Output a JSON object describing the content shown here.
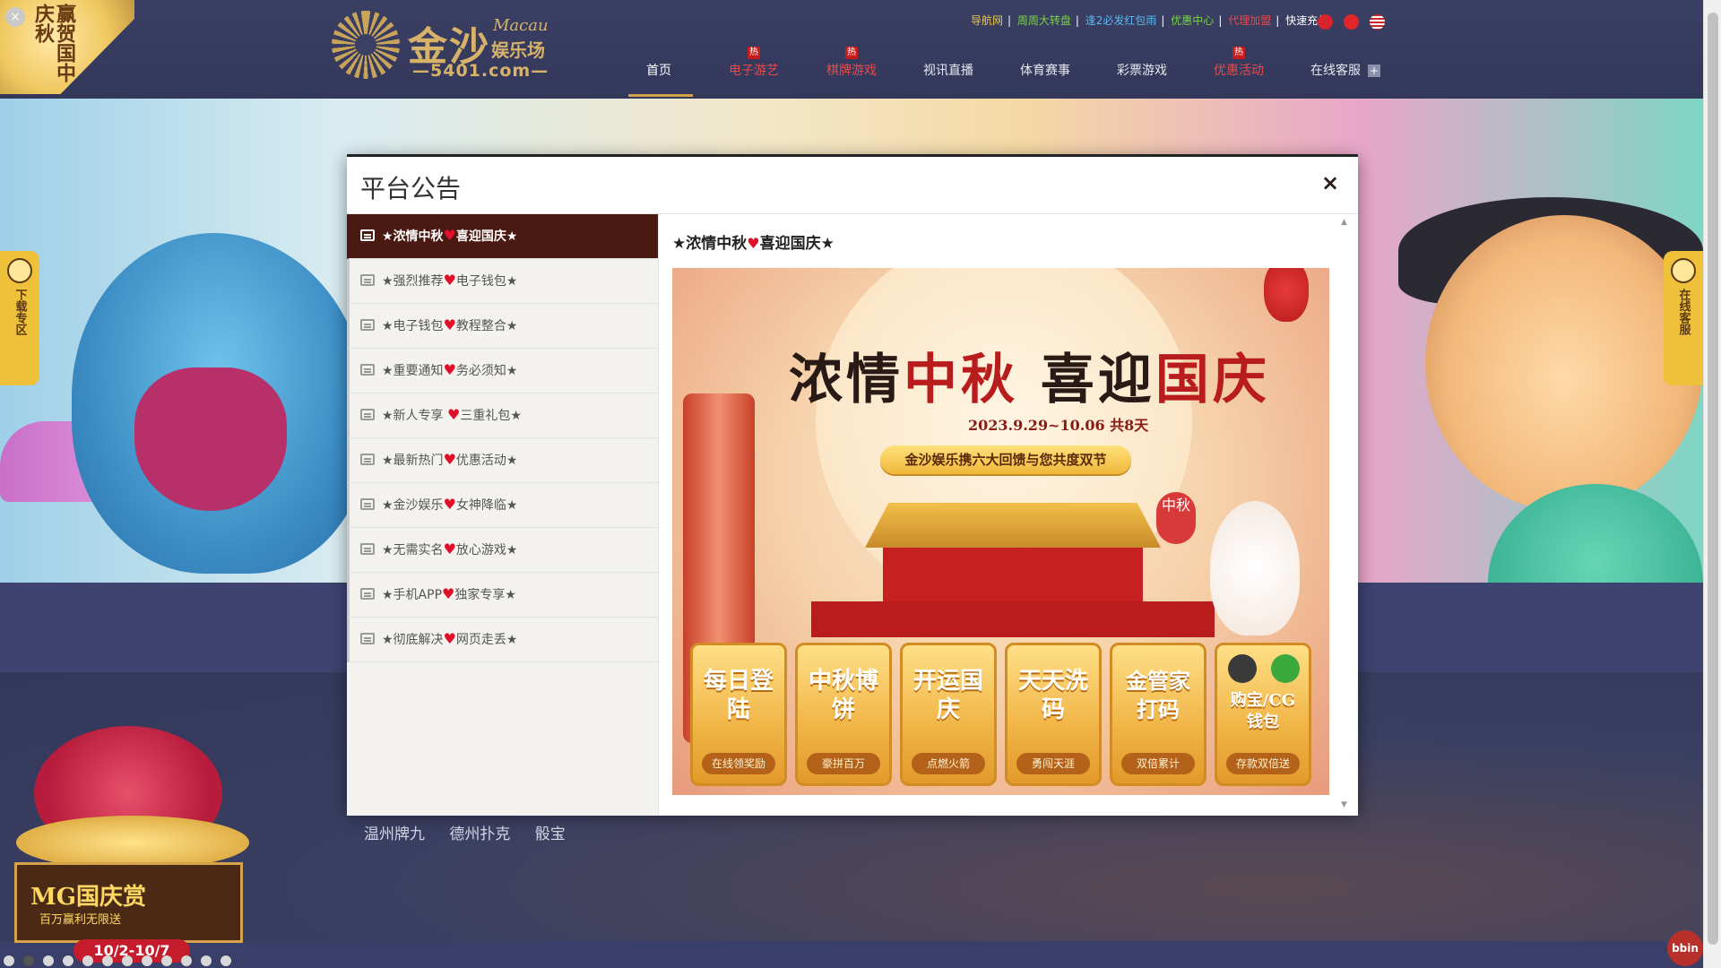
{
  "header": {
    "festival_text": "赢贺国中庆秋",
    "logo_main": "金沙",
    "logo_macau": "Macau",
    "logo_sub": "娱乐场",
    "logo_domain": "—5401.com—",
    "top_links": [
      {
        "label": "导航网",
        "color": "#e6c84a"
      },
      {
        "label": "周周大转盘",
        "color": "#7ad24a"
      },
      {
        "label": "逢2必发红包雨",
        "color": "#5ab8f0"
      },
      {
        "label": "优惠中心",
        "color": "#7ad24a"
      },
      {
        "label": "代理加盟",
        "color": "#e84a4a"
      },
      {
        "label": "快速充值",
        "color": "#ffffff"
      }
    ],
    "flags": [
      "hk-flag-icon",
      "cn-flag-icon",
      "us-flag-icon"
    ],
    "nav": [
      {
        "label": "首页",
        "hot": false,
        "color": "#ffffff"
      },
      {
        "label": "电子游艺",
        "hot": true,
        "color": "#e84a4a"
      },
      {
        "label": "棋牌游戏",
        "hot": true,
        "color": "#e84a4a"
      },
      {
        "label": "视讯直播",
        "hot": false,
        "color": "#e8e8f0"
      },
      {
        "label": "体育赛事",
        "hot": false,
        "color": "#e8e8f0"
      },
      {
        "label": "彩票游戏",
        "hot": false,
        "color": "#e8e8f0"
      },
      {
        "label": "优惠活动",
        "hot": true,
        "color": "#e84a4a"
      },
      {
        "label": "在线客服",
        "hot": false,
        "color": "#e8e8f0"
      }
    ],
    "hot_label": "热"
  },
  "side_tabs": {
    "left": "下载专区",
    "right": "在线客服"
  },
  "lower": {
    "poker_games": [
      "温州牌九",
      "德州扑克",
      "骰宝"
    ],
    "mg_title": "MG国庆赏",
    "mg_sub": "百万赢利无限送",
    "mg_date": "10/2-10/7",
    "bbin": "bbin"
  },
  "modal": {
    "title": "平台公告",
    "close_icon": "×",
    "notices": [
      {
        "pre": "★浓情中秋",
        "post": "喜迎国庆★",
        "active": true
      },
      {
        "pre": "★强烈推荐",
        "post": "电子钱包★",
        "active": false
      },
      {
        "pre": "★电子钱包",
        "post": "教程整合★",
        "active": false
      },
      {
        "pre": "★重要通知",
        "post": "务必须知★",
        "active": false
      },
      {
        "pre": "★新人专享 ",
        "post": "三重礼包★",
        "active": false
      },
      {
        "pre": "★最新热门",
        "post": "优惠活动★",
        "active": false
      },
      {
        "pre": "★金沙娱乐",
        "post": "女神降临★",
        "active": false
      },
      {
        "pre": "★无需实名",
        "post": "放心游戏★",
        "active": false
      },
      {
        "pre": "★手机APP",
        "post": "独家专享★",
        "active": false
      },
      {
        "pre": "★彻底解决",
        "post": "网页走丢★",
        "active": false
      }
    ],
    "content_title_pre": "★浓情中秋",
    "content_title_post": "喜迎国庆★",
    "poster": {
      "title_a": "浓情",
      "title_b": "中秋",
      "title_c": "喜迎",
      "title_d": "国庆",
      "date": "2023.9.29~10.06 共8天",
      "badge": "金沙娱乐携六大回馈与您共度双节",
      "moon_badge": "中秋",
      "cards": [
        {
          "main": "每日登陆",
          "sub": "在线领奖励"
        },
        {
          "main": "中秋博饼",
          "sub": "豪拼百万"
        },
        {
          "main": "开运国庆",
          "sub": "点燃火箭"
        },
        {
          "main": "天天洗码",
          "sub": "勇闯天涯"
        },
        {
          "main": "金管家打码",
          "sub": "双倍累计"
        },
        {
          "main": "购宝/CG钱包",
          "sub": "存款双倍送"
        }
      ]
    }
  },
  "pager": {
    "count": 12,
    "active_index": 1
  }
}
